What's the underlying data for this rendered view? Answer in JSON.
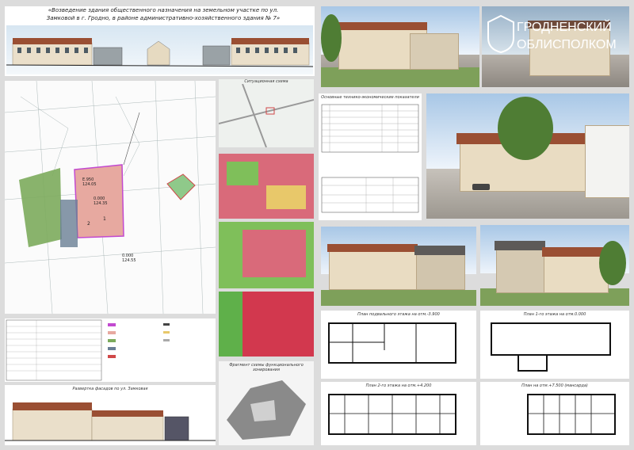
{
  "header": {
    "title_line1": "«Возведение здания общественного назначения на земельном участке по ул.",
    "title_line2": "Замковой в г. Гродно, в районе административно-хозяйственного здания № 7»"
  },
  "logo": {
    "line1": "ГРОДНЕНСКИЙ",
    "line2": "ОБЛИСПОЛКОМ"
  },
  "captions": {
    "situational_scheme": "Ситуационная схема",
    "zoning_scheme": "Фрагмент схемы функционального зонирования",
    "street_facade": "Развертка фасадов по ул. Замковая",
    "basement_plan": "План подвального этажа на отм.-3.900",
    "first_floor_plan": "План 1-го этажа на отм.0.000",
    "second_floor_plan": "План 2-го этажа на отм.+4.200",
    "attic_plan": "План на отм.+7.500 (мансарда)",
    "table_title": "Основные технико-экономические показатели"
  },
  "site_plan": {
    "labels": [
      "1",
      "2",
      "Е.950",
      "124.05",
      "0.000",
      "124.35",
      "0.000",
      "124.55"
    ]
  },
  "colors": {
    "roof": "#9a4f33",
    "facade": "#e9dcc2",
    "plot_outline": "#c24ad0",
    "plot_fill": "#e7a9a0",
    "park": "#7cab5c"
  }
}
